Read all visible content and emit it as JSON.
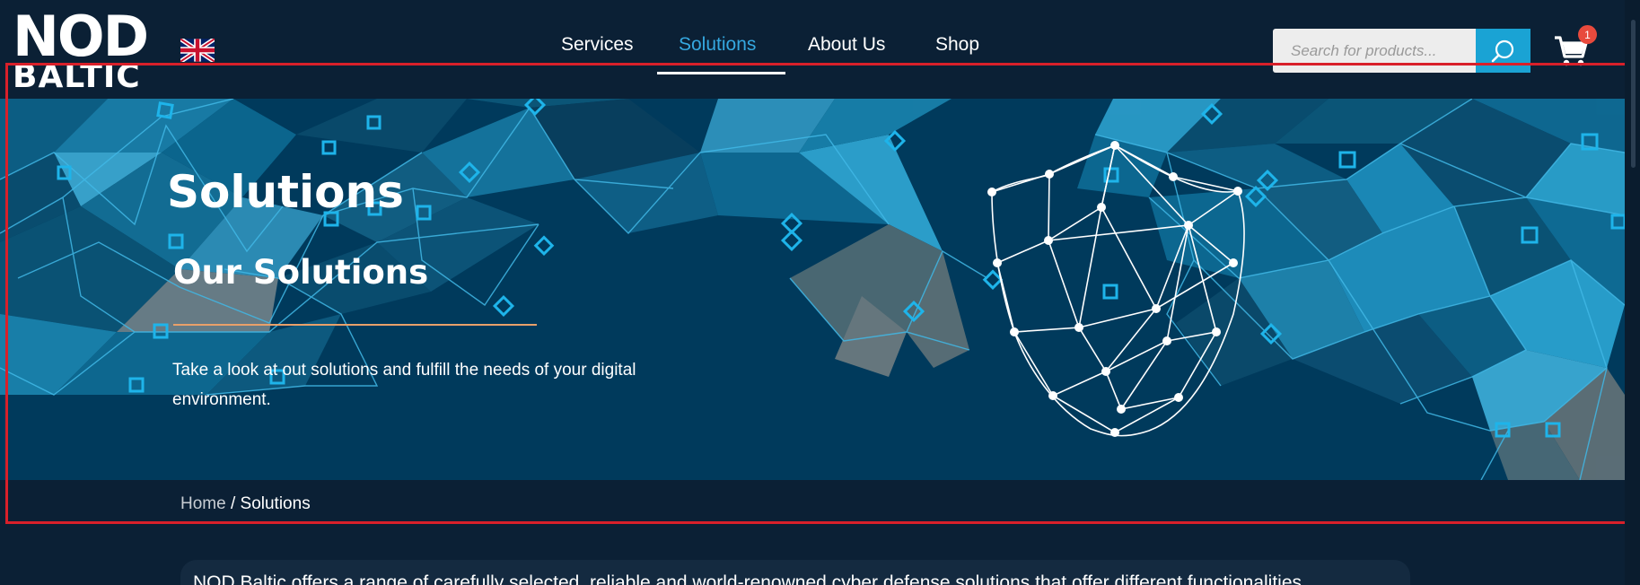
{
  "brand": {
    "logo_line1": "NOD",
    "logo_line2": "BALTIC"
  },
  "language": {
    "icon": "uk-flag-icon"
  },
  "nav": {
    "items": [
      {
        "label": "Services",
        "active": false
      },
      {
        "label": "Solutions",
        "active": true
      },
      {
        "label": "About Us",
        "active": false
      },
      {
        "label": "Shop",
        "active": false
      }
    ]
  },
  "search": {
    "placeholder": "Search for products...",
    "icon": "search-icon"
  },
  "cart": {
    "icon": "cart-icon",
    "count": "1"
  },
  "hero": {
    "title": "Solutions",
    "subtitle": "Our Solutions",
    "text": "Take a look at out solutions and fulfill the needs of your digital environment."
  },
  "breadcrumb": {
    "home": "Home",
    "separator": "/",
    "current": "Solutions"
  },
  "intro": {
    "text": "NOD Baltic offers a range of carefully selected, reliable and world-renowned cyber defense solutions that offer different functionalities"
  },
  "colors": {
    "header_bg": "#0b2035",
    "hero_bg": "#003a5c",
    "accent": "#35a8e0",
    "search_button": "#1aa3d4",
    "badge": "#e84a3d",
    "rule": "#e8a06a",
    "outline": "#d8202a"
  }
}
